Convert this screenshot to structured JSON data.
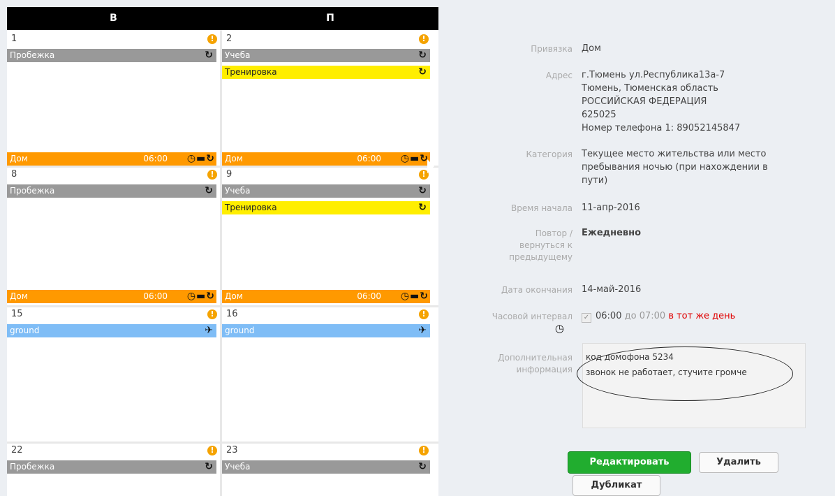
{
  "calendar": {
    "day_headers": [
      "В",
      "П"
    ],
    "weeks": [
      {
        "cells": [
          {
            "num": "1",
            "events": [
              {
                "label": "Пробежка",
                "color": "gray",
                "icon": "sync-icon"
              }
            ],
            "stay": {
              "label": "Дом",
              "time": "06:00"
            }
          },
          {
            "num": "2",
            "events": [
              {
                "label": "Учеба",
                "color": "gray",
                "icon": "sync-icon"
              },
              {
                "label": "Тренировка",
                "color": "yellow",
                "icon": "sync-icon"
              }
            ],
            "stay": {
              "label": "Дом",
              "time": "06:00"
            }
          }
        ]
      },
      {
        "cells": [
          {
            "num": "8",
            "events": [
              {
                "label": "Пробежка",
                "color": "gray",
                "icon": "sync-icon"
              }
            ],
            "stay": {
              "label": "Дом",
              "time": "06:00"
            }
          },
          {
            "num": "9",
            "events": [
              {
                "label": "Учеба",
                "color": "gray",
                "icon": "sync-icon"
              },
              {
                "label": "Тренировка",
                "color": "yellow",
                "icon": "sync-icon"
              }
            ],
            "stay": {
              "label": "Дом",
              "time": "06:00"
            }
          }
        ]
      },
      {
        "cells": [
          {
            "num": "15",
            "events": [
              {
                "label": "ground",
                "color": "blue",
                "icon": "plane-icon"
              }
            ]
          },
          {
            "num": "16",
            "events": [
              {
                "label": "ground",
                "color": "blue",
                "icon": "plane-icon"
              }
            ]
          }
        ]
      },
      {
        "cells": [
          {
            "num": "22",
            "events": [
              {
                "label": "Пробежка",
                "color": "gray",
                "icon": "sync-icon"
              }
            ]
          },
          {
            "num": "23",
            "events": [
              {
                "label": "Учеба",
                "color": "gray",
                "icon": "sync-icon"
              }
            ]
          }
        ]
      }
    ]
  },
  "detail": {
    "binding_label": "Привязка",
    "binding_value": "Дом",
    "address_label": "Адрес",
    "address_lines": [
      "г.Тюмень ул.Республика13а-7",
      "Тюмень, Тюменская область",
      "РОССИЙСКАЯ ФЕДЕРАЦИЯ",
      "625025",
      "Номер телефона 1: 89052145847"
    ],
    "category_label": "Категория",
    "category_lines": [
      "Текущее место жительства или место",
      "пребывания ночью (при нахождении в",
      "пути)"
    ],
    "start_label": "Время начала",
    "start_value": "11-апр-2016",
    "repeat_label_lines": [
      "Повтор /",
      "вернуться к",
      "предыдущему"
    ],
    "repeat_value": "Ежедневно",
    "end_label": "Дата окончания",
    "end_value": "14-май-2016",
    "interval_label": "Часовой интервал",
    "interval_from": "06:00",
    "interval_to_word": "до",
    "interval_to": "07:00",
    "interval_same_day": "в тот же день",
    "extra_label_lines": [
      "Дополнительная",
      "информация"
    ],
    "extra_lines": [
      "код домофона 5234",
      "звонок не работает, стучите громче"
    ]
  },
  "buttons": {
    "edit": "Редактировать",
    "delete": "Удалить",
    "duplicate": "Дубликат"
  },
  "colors": {
    "gray": "#999999",
    "yellow": "#ffee00",
    "blue": "#7fbdf6",
    "orange": "#ff9900",
    "edit_button": "#21ad2f",
    "same_day": "#e00000"
  }
}
